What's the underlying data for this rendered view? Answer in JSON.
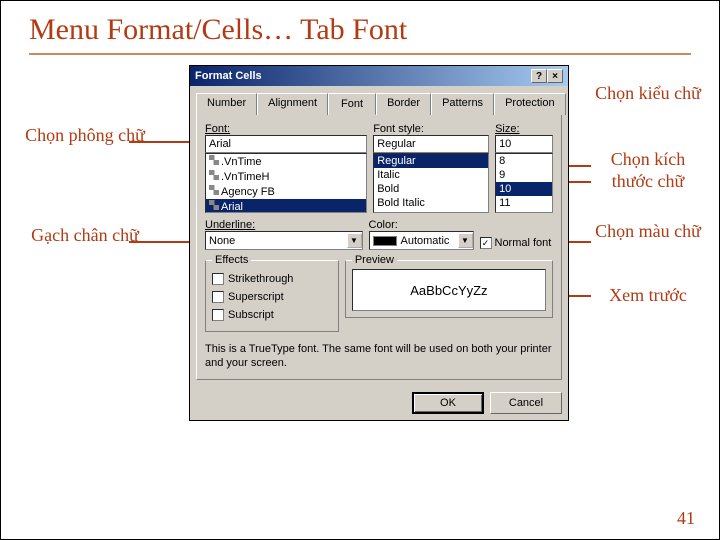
{
  "title": "Menu Format/Cells… Tab Font",
  "annotations": {
    "font": "Chọn phông chữ",
    "style": "Chọn kiểu chữ",
    "size": "Chọn kích thước chữ",
    "underline": "Gạch chân chữ",
    "color": "Chọn màu chữ",
    "preview": "Xem trước"
  },
  "dialog": {
    "title": "Format Cells",
    "tabs": [
      "Number",
      "Alignment",
      "Font",
      "Border",
      "Patterns",
      "Protection"
    ],
    "labels": {
      "font": "Font:",
      "style": "Font style:",
      "size": "Size:",
      "underline": "Underline:",
      "color": "Color:",
      "effects": "Effects",
      "preview": "Preview",
      "normalFont": "Normal font",
      "strike": "Strikethrough",
      "super": "Superscript",
      "sub": "Subscript"
    },
    "font": {
      "value": "Arial",
      "options": [
        ".VnTime",
        ".VnTimeH",
        "Agency FB",
        "Arial"
      ]
    },
    "style": {
      "value": "Regular",
      "options": [
        "Regular",
        "Italic",
        "Bold",
        "Bold Italic"
      ]
    },
    "size": {
      "value": "10",
      "options": [
        "8",
        "9",
        "10",
        "11"
      ]
    },
    "underline": "None",
    "color": "Automatic",
    "previewText": "AaBbCcYyZz",
    "note": "This is a TrueType font. The same font will be used on both your printer and your screen.",
    "buttons": {
      "ok": "OK",
      "cancel": "Cancel"
    }
  },
  "slideNumber": "41"
}
